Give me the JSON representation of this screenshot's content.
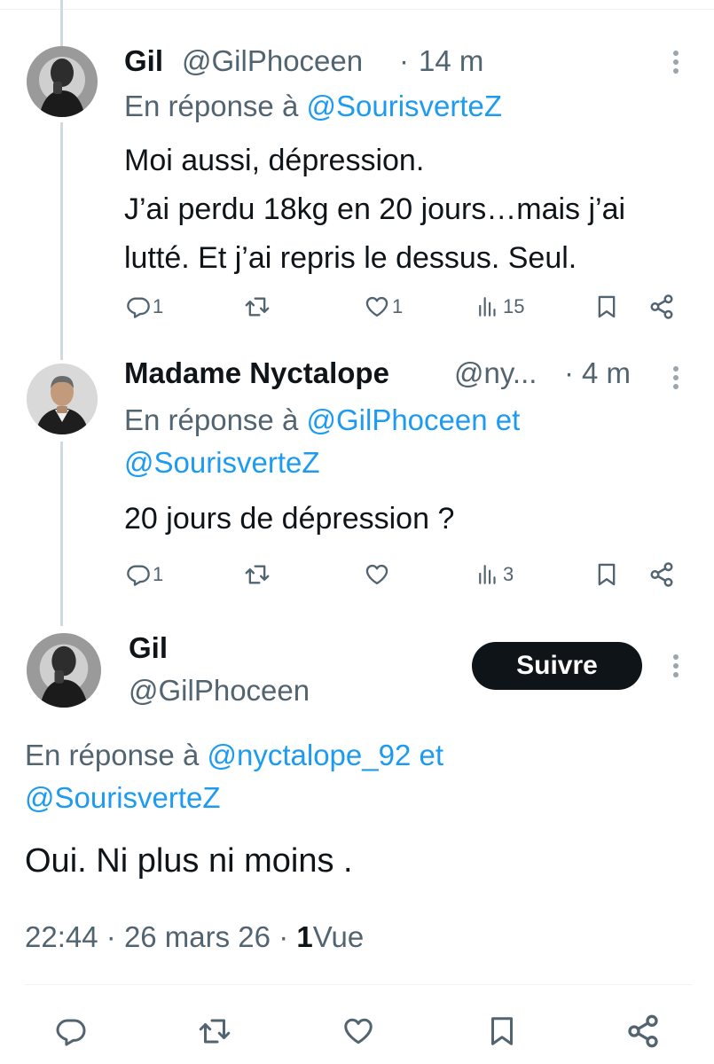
{
  "tweets": [
    {
      "name": "Gil",
      "handle": "@GilPhoceen",
      "sep": "·",
      "time": "14 m",
      "reply_prefix": "En réponse à",
      "reply_mention1": "@SourisverteZ",
      "lines": [
        "Moi aussi, dépression.",
        "J’ai perdu 18kg en 20 jours…mais j’ai",
        "lutté. Et j’ai repris le dessus. Seul."
      ],
      "replies": "1",
      "likes": "1",
      "views": "15"
    },
    {
      "name": "Madame Nyctalope",
      "handle": "@ny...",
      "sep": "·",
      "time": "4 m",
      "reply_prefix": "En réponse à",
      "reply_mention1": "@GilPhoceen",
      "reply_and": "et",
      "reply_mention2": "@SourisverteZ",
      "lines": [
        "20 jours de dépression ?"
      ],
      "replies": "1",
      "views": "3"
    }
  ],
  "main": {
    "name": "Gil",
    "handle": "@GilPhoceen",
    "follow_label": "Suivre",
    "reply_prefix": "En réponse à",
    "reply_mention1": "@nyctalope_92",
    "reply_and": "et",
    "reply_mention2": "@SourisverteZ",
    "text": "Oui. Ni plus ni moins .",
    "time": "22:44",
    "sep": "·",
    "date": "26 mars 26",
    "views_count": "1",
    "views_label": "Vue"
  },
  "icons": [
    "reply-icon",
    "retweet-icon",
    "like-icon",
    "views-icon",
    "bookmark-icon",
    "share-icon",
    "more-icon"
  ],
  "colors": {
    "text": "#0f1419",
    "muted": "#536471",
    "link": "#1d9bf0",
    "line": "#cfd9de",
    "button": "#0f1419"
  }
}
